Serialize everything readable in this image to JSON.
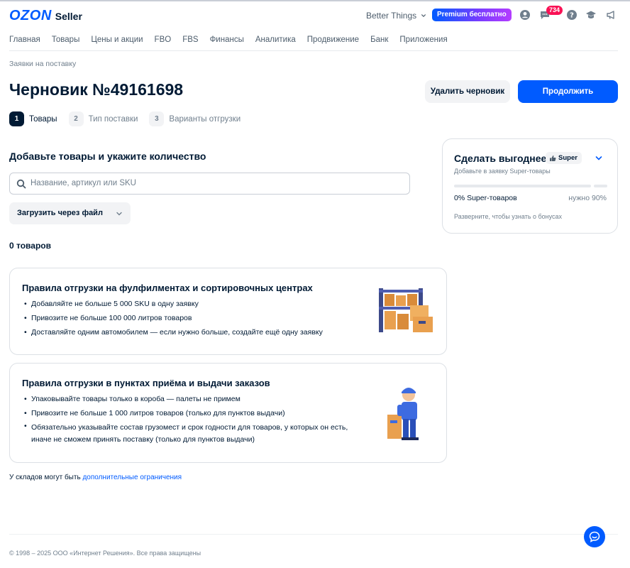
{
  "header": {
    "logo_brand": "OZON",
    "logo_product": "Seller",
    "store_name": "Better Things",
    "premium_label": "Premium бесплатно",
    "notifications_count": "734"
  },
  "nav": {
    "items": [
      {
        "label": "Главная"
      },
      {
        "label": "Товары"
      },
      {
        "label": "Цены и акции"
      },
      {
        "label": "FBO"
      },
      {
        "label": "FBS"
      },
      {
        "label": "Финансы"
      },
      {
        "label": "Аналитика"
      },
      {
        "label": "Продвижение"
      },
      {
        "label": "Банк"
      },
      {
        "label": "Приложения"
      }
    ]
  },
  "breadcrumb": "Заявки на поставку",
  "page_title": "Черновик №49161698",
  "actions": {
    "delete_label": "Удалить черновик",
    "continue_label": "Продолжить"
  },
  "steps": [
    {
      "num": "1",
      "label": "Товары"
    },
    {
      "num": "2",
      "label": "Тип поставки"
    },
    {
      "num": "3",
      "label": "Варианты отгрузки"
    }
  ],
  "main": {
    "section_title": "Добавьте товары и укажите количество",
    "search_placeholder": "Название, артикул или SKU",
    "upload_label": "Загрузить через файл",
    "items_count": "0 товаров"
  },
  "rules": [
    {
      "title": "Правила отгрузки на фулфилментах и сортировочных центрах",
      "items": [
        "Добавляйте не больше 5 000 SKU в одну заявку",
        "Привозите не больше 100 000 литров товаров",
        "Доставляйте одним автомобилем — если нужно больше, создайте ещё одну заявку"
      ]
    },
    {
      "title": "Правила отгрузки в пунктах приёма и выдачи заказов",
      "items": [
        "Упаковывайте товары только в короба — палеты не примем",
        "Привозите не больше 1 000 литров товаров (только для пунктов выдачи)",
        "Обязательно указывайте состав грузомест и срок годности для товаров, у которых он есть, иначе не сможем принять поставку (только для пунктов выдачи)"
      ]
    }
  ],
  "warehouse_note": {
    "text": "У складов могут быть ",
    "link": "дополнительные ограничения"
  },
  "side": {
    "title": "Сделать выгоднее",
    "chip": "Super",
    "subtitle": "Добавьте в заявку Super-товары",
    "progress_fraction": 0,
    "progress_left": "0% Super-товаров",
    "progress_right": "нужно 90%",
    "hint": "Разверните, чтобы узнать о бонусах"
  },
  "footer": "© 1998 – 2025 ООО «Интернет Решения». Все права защищены",
  "colors": {
    "accent": "#005bff",
    "text": "#001a34",
    "muted": "#707f8d",
    "badge": "#f91155"
  }
}
